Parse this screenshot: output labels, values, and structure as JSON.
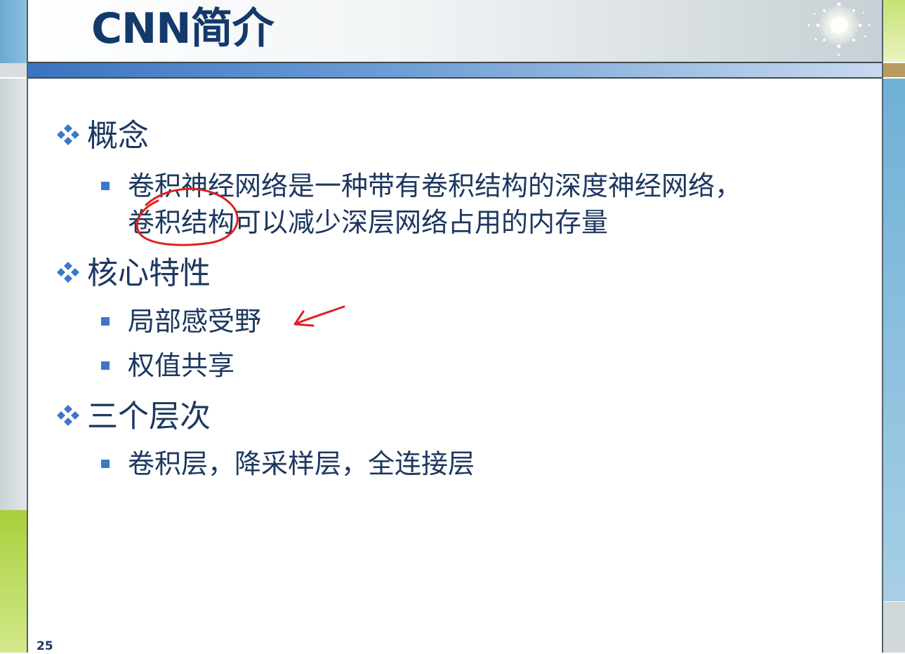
{
  "slide": {
    "title": "CNN简介",
    "page_number": "25"
  },
  "sections": [
    {
      "heading": "概念",
      "items": [
        {
          "line1": "卷积神经网络是一种带有卷积结构的深度神经网络，",
          "line2": "卷积结构可以减少深层网络占用的内存量"
        }
      ]
    },
    {
      "heading": "核心特性",
      "items": [
        {
          "line1": "局部感受野"
        },
        {
          "line1": "权值共享"
        }
      ]
    },
    {
      "heading": "三个层次",
      "items": [
        {
          "line1": "卷积层，降采样层，全连接层"
        }
      ]
    }
  ],
  "colors": {
    "text": "#1d3860",
    "title": "#14396b",
    "bullet_diamond": "#3a78c8",
    "bullet_square": "#3a78c8",
    "annotation_ink": "#e02020"
  },
  "icons": {
    "level1_bullet": "four-diamond-bullet-icon",
    "level2_bullet": "square-bullet-icon",
    "annotation_circle": "ink-circle-annotation",
    "annotation_arrow": "ink-arrow-annotation"
  }
}
